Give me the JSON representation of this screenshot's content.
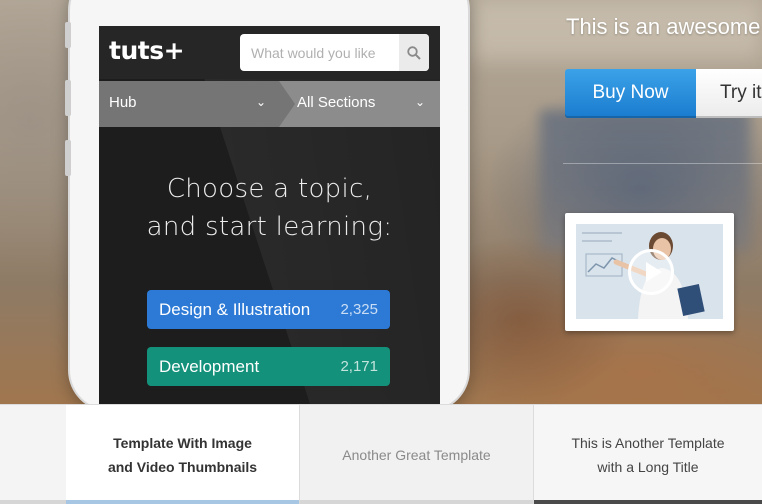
{
  "app": {
    "logo": "tuts+",
    "search_placeholder": "What would you like",
    "nav": {
      "hub": "Hub",
      "sections": "All Sections",
      "chevron": "⌄"
    },
    "headline_line1": "Choose a topic,",
    "headline_line2": "and start learning:",
    "topics": [
      {
        "label": "Design & Illustration",
        "count": "2,325",
        "color": "#2c7ad6"
      },
      {
        "label": "Development",
        "count": "2,171",
        "color": "#13917a"
      }
    ]
  },
  "hero": {
    "tagline": "This is an awesome",
    "buy_label": "Buy Now",
    "try_label": "Try it",
    "accent": "#1f86d8"
  },
  "video": {
    "icon": "play-icon"
  },
  "tabs": [
    {
      "line1": "Template With Image",
      "line2": "and Video Thumbnails",
      "active": true
    },
    {
      "line1": "Another Great Template",
      "line2": "",
      "active": false
    },
    {
      "line1": "This is Another Template",
      "line2": "with a Long Title",
      "active": false
    }
  ],
  "colors": {
    "tab_active_bar": "#a7c6e3",
    "tab_dark_bar": "#4a4a4a",
    "tab_grey_bar": "#d6d6d6"
  }
}
